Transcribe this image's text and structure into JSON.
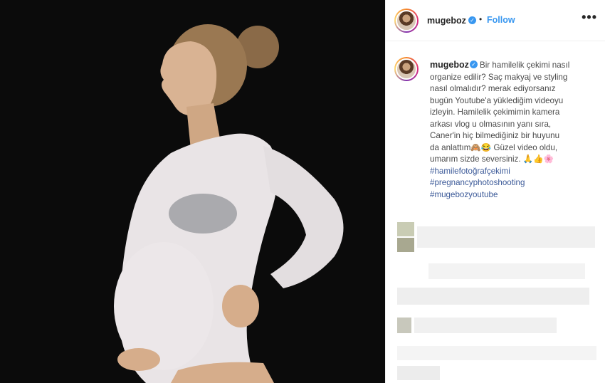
{
  "post": {
    "username": "mugeboz",
    "follow_label": "Follow",
    "dot": "•",
    "more_label": "•••"
  },
  "caption": {
    "username": "mugeboz",
    "lines": [
      "Bir hamilelik çekimi nasıl",
      "organize edilir? Saç makyaj ve styling",
      "nasıl olmalıdır? merak ediyorsanız",
      "bugün Youtube'a yüklediğim videoyu",
      "izleyin. Hamilelik çekimimin kamera",
      "arkası vlog u olmasının yanı sıra,",
      "Caner'in hiç bilmediğiniz bir huyunu",
      "da anlattım🙈😂 Güzel video oldu,",
      "umarım sizde seversiniz. 🙏👍🌸"
    ],
    "hashtags": [
      "#hamilefotoğrafçekimi",
      "#pregnancyphotoshooting",
      "#mugebozyoutube"
    ]
  },
  "colors": {
    "link": "#3897f0",
    "hashtag": "#3b5998",
    "photo_bg": "#0b0b0b"
  },
  "icons": {
    "verified": "verified-badge-icon",
    "more": "more-options-icon"
  }
}
